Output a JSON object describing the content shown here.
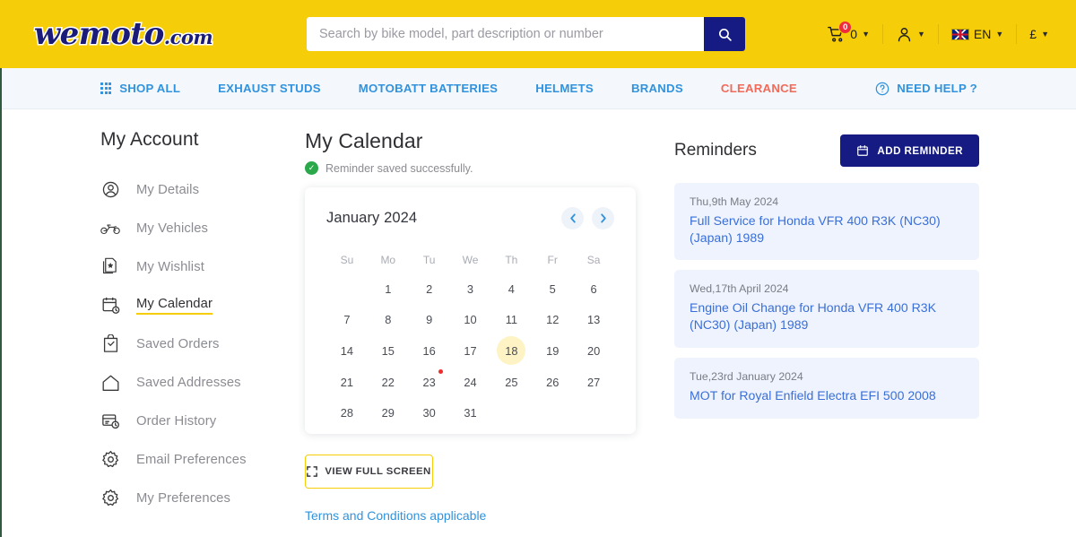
{
  "header": {
    "logo_text": "wemoto",
    "logo_suffix": ".com",
    "search": {
      "placeholder": "Search by bike model, part description or number",
      "value": "",
      "button_icon": "search-icon"
    },
    "cart": {
      "count": "0",
      "badge": "0",
      "icon": "cart-icon"
    },
    "account": {
      "icon": "user-icon"
    },
    "language": {
      "label": "EN",
      "flag": "uk-flag-icon"
    },
    "currency": {
      "label": "£"
    }
  },
  "nav": {
    "items": [
      {
        "label": "SHOP ALL",
        "icon": "grid-icon",
        "style": "link"
      },
      {
        "label": "EXHAUST STUDS",
        "style": "link"
      },
      {
        "label": "MOTOBATT BATTERIES",
        "style": "link"
      },
      {
        "label": "HELMETS",
        "style": "link"
      },
      {
        "label": "BRANDS",
        "style": "link"
      },
      {
        "label": "CLEARANCE",
        "style": "clearance"
      }
    ],
    "help": {
      "label": "NEED HELP ?",
      "icon": "question-circle-icon"
    }
  },
  "sidebar": {
    "title": "My Account",
    "items": [
      {
        "label": "My Details",
        "icon": "user-circle-icon",
        "active": false
      },
      {
        "label": "My Vehicles",
        "icon": "motorcycle-icon",
        "active": false
      },
      {
        "label": "My Wishlist",
        "icon": "wishlist-icon",
        "active": false
      },
      {
        "label": "My Calendar",
        "icon": "calendar-clock-icon",
        "active": true
      },
      {
        "label": "Saved Orders",
        "icon": "bag-icon",
        "active": false
      },
      {
        "label": "Saved Addresses",
        "icon": "home-icon",
        "active": false
      },
      {
        "label": "Order History",
        "icon": "history-icon",
        "active": false
      },
      {
        "label": "Email Preferences",
        "icon": "gear-icon",
        "active": false
      },
      {
        "label": "My Preferences",
        "icon": "gear-icon",
        "active": false
      }
    ]
  },
  "main": {
    "title": "My Calendar",
    "alert": {
      "text": "Reminder saved successfully.",
      "icon": "check-circle-icon",
      "color": "#2aa84a"
    },
    "calendar": {
      "month_label": "January 2024",
      "prev_icon": "chevron-left-icon",
      "next_icon": "chevron-right-icon",
      "day_names": [
        "Su",
        "Mo",
        "Tu",
        "We",
        "Th",
        "Fr",
        "Sa"
      ],
      "leading_blanks": 1,
      "days": [
        {
          "n": "1"
        },
        {
          "n": "2"
        },
        {
          "n": "3"
        },
        {
          "n": "4"
        },
        {
          "n": "5"
        },
        {
          "n": "6"
        },
        {
          "n": "7"
        },
        {
          "n": "8"
        },
        {
          "n": "9"
        },
        {
          "n": "10"
        },
        {
          "n": "11"
        },
        {
          "n": "12"
        },
        {
          "n": "13"
        },
        {
          "n": "14"
        },
        {
          "n": "15"
        },
        {
          "n": "16"
        },
        {
          "n": "17"
        },
        {
          "n": "18",
          "today": true
        },
        {
          "n": "19"
        },
        {
          "n": "20"
        },
        {
          "n": "21"
        },
        {
          "n": "22"
        },
        {
          "n": "23",
          "event": true
        },
        {
          "n": "24"
        },
        {
          "n": "25"
        },
        {
          "n": "26"
        },
        {
          "n": "27"
        },
        {
          "n": "28"
        },
        {
          "n": "29"
        },
        {
          "n": "30"
        },
        {
          "n": "31"
        }
      ],
      "highlight_color": "#fdf3c4",
      "event_dot_color": "#ef2b2b"
    },
    "fullscreen_button": {
      "label": "VIEW FULL SCREEN",
      "icon": "expand-icon"
    },
    "terms_link": "Terms and Conditions applicable"
  },
  "reminders": {
    "title": "Reminders",
    "add_button": {
      "label": "ADD REMINDER",
      "icon": "calendar-icon"
    },
    "items": [
      {
        "date": "Thu,9th May 2024",
        "title": "Full Service for Honda VFR 400 R3K (NC30) (Japan) 1989"
      },
      {
        "date": "Wed,17th April 2024",
        "title": "Engine Oil Change for Honda VFR 400 R3K (NC30) (Japan) 1989"
      },
      {
        "date": "Tue,23rd January 2024",
        "title": "MOT for Royal Enfield Electra EFI 500 2008"
      }
    ]
  },
  "colors": {
    "header_yellow": "#f5cd08",
    "nav_bg": "#f4f7fb",
    "brand_blue": "#151b82",
    "link_blue": "#3193dd",
    "clearance_red": "#f26a5a",
    "card_bg": "#eef3fd",
    "left_stripe": "#2f5a3f"
  }
}
